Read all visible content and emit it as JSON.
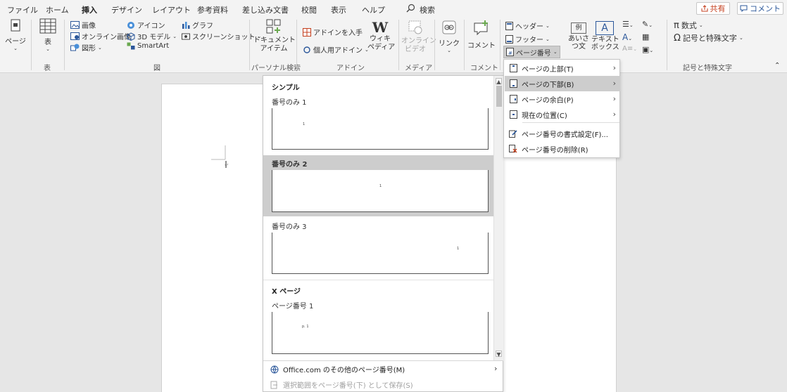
{
  "menubar": {
    "tabs": [
      "ファイル",
      "ホーム",
      "挿入",
      "デザイン",
      "レイアウト",
      "参考資料",
      "差し込み文書",
      "校閲",
      "表示",
      "ヘルプ"
    ],
    "search": "検索",
    "share": "共有",
    "comment": "コメント"
  },
  "ribbon": {
    "page_btn": "ページ",
    "table_btn": "表",
    "picture": "画像",
    "online_picture": "オンライン画像",
    "shapes": "図形",
    "icons": "アイコン",
    "models_3d": "3D モデル",
    "smartart": "SmartArt",
    "chart": "グラフ",
    "screenshot": "スクリーンショット",
    "doc_item_1": "ドキュメント",
    "doc_item_2": "アイテム",
    "get_addins": "アドインを入手",
    "my_addins": "個人用アドイン",
    "wiki_1": "ウィキ",
    "wiki_2": "ペディア",
    "online_video_1": "オンライン",
    "online_video_2": "ビデオ",
    "link": "リンク",
    "comment": "コメント",
    "header": "ヘッダー",
    "footer": "フッター",
    "page_number": "ページ番号",
    "aisatsu_1": "あいさ",
    "aisatsu_2": "つ文",
    "textbox_1": "テキスト",
    "textbox_2": "ボックス",
    "equation": "数式",
    "symbol": "記号と特殊文字",
    "groups": {
      "table": "表",
      "illustrations": "図",
      "personal_search": "パーソナル検索",
      "addins": "アドイン",
      "media": "メディア",
      "comment": "コメント",
      "symbols": "記号と特殊文字"
    }
  },
  "gallery": {
    "section_simple": "シンプル",
    "item1": "番号のみ 1",
    "item2": "番号のみ 2",
    "item3": "番号のみ 3",
    "section_x": "X ページ",
    "item4": "ページ番号 1",
    "thumb_num": "1",
    "thumb_p1": "p. 1",
    "footer_more": "Office.com のその他のページ番号(M)",
    "footer_save": "選択範囲をページ番号(下) として保存(S)"
  },
  "context_menu": [
    {
      "label": "ページの上部(T)",
      "arrow": true
    },
    {
      "label": "ページの下部(B)",
      "arrow": true
    },
    {
      "label": "ページの余白(P)",
      "arrow": true
    },
    {
      "label": "現在の位置(C)",
      "arrow": true
    },
    {
      "label": "ページ番号の書式設定(F)...",
      "arrow": false
    },
    {
      "label": "ページ番号の削除(R)",
      "arrow": false
    }
  ],
  "colors": {
    "accent": "#2b579a",
    "share": "#c43e1c",
    "highlight": "#cdcdcd"
  }
}
